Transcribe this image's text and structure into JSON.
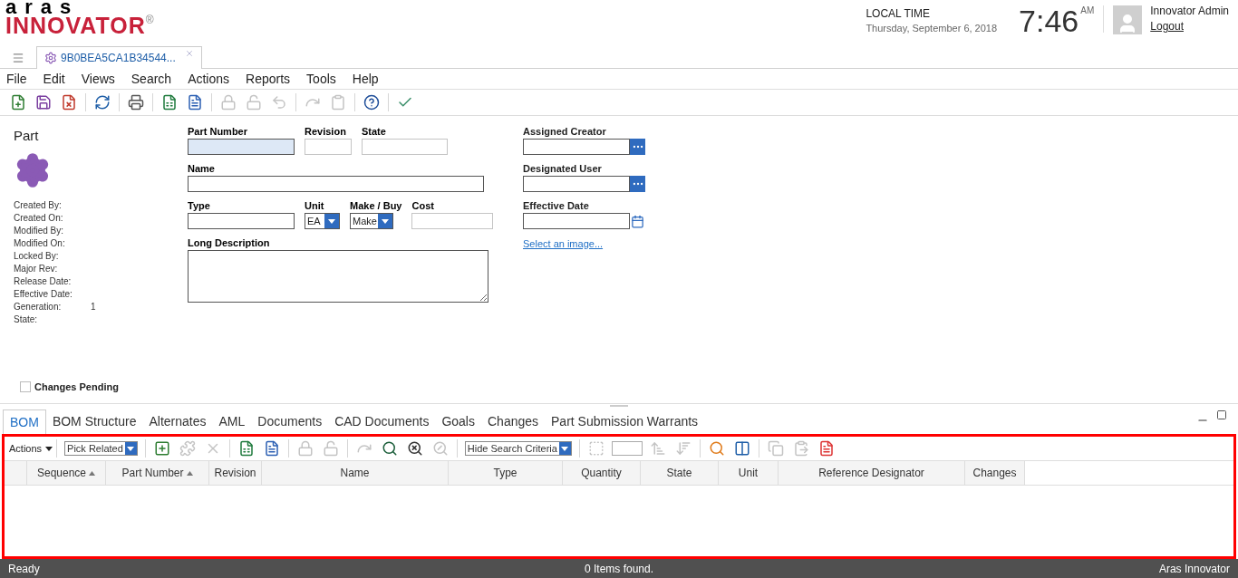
{
  "header": {
    "logo_top": "aras",
    "logo_main": "INNOVATOR",
    "logo_mark": "®",
    "local_time_label": "LOCAL TIME",
    "date": "Thursday, September 6, 2018",
    "time": "7:46",
    "meridiem": "AM",
    "user": "Innovator Admin",
    "logout": "Logout"
  },
  "doc_tab": {
    "title": "9B0BEA5CA1B34544...",
    "selected": true
  },
  "menu": [
    "File",
    "Edit",
    "Views",
    "Search",
    "Actions",
    "Reports",
    "Tools",
    "Help"
  ],
  "toolbar": [
    {
      "kind": "icon",
      "disabled": false
    },
    {
      "kind": "icon",
      "disabled": false
    },
    {
      "kind": "icon",
      "disabled": false
    },
    {
      "kind": "separator"
    },
    {
      "kind": "icon",
      "disabled": false
    },
    {
      "kind": "separator"
    },
    {
      "kind": "icon",
      "disabled": false
    },
    {
      "kind": "separator"
    },
    {
      "kind": "icon",
      "disabled": false
    },
    {
      "kind": "icon",
      "disabled": false
    },
    {
      "kind": "separator"
    },
    {
      "kind": "icon",
      "disabled": true
    },
    {
      "kind": "icon",
      "disabled": true
    },
    {
      "kind": "icon",
      "disabled": true
    },
    {
      "kind": "separator"
    },
    {
      "kind": "icon",
      "disabled": true
    },
    {
      "kind": "icon",
      "disabled": true
    },
    {
      "kind": "separator"
    },
    {
      "kind": "icon",
      "disabled": false
    },
    {
      "kind": "separator"
    },
    {
      "kind": "icon",
      "disabled": false
    }
  ],
  "item": {
    "type": "Part",
    "meta": [
      {
        "label": "Created By:"
      },
      {
        "label": "Created On:"
      },
      {
        "label": "Modified By:"
      },
      {
        "label": "Modified On:"
      },
      {
        "label": "Locked By:"
      },
      {
        "label": "Major Rev:"
      },
      {
        "label": "Release Date:"
      },
      {
        "label": "Effective Date:"
      },
      {
        "label": "Generation:",
        "value": "1"
      },
      {
        "label": "State:"
      }
    ],
    "changes_pending": {
      "label": "Changes Pending",
      "checked": false
    }
  },
  "form_rows": [
    [
      {
        "label": "Part Number",
        "kind": "text",
        "required": true,
        "disabled": false
      },
      {
        "label": "Revision",
        "kind": "text",
        "required": false,
        "disabled": true
      },
      {
        "label": "State",
        "kind": "text",
        "required": false,
        "disabled": true
      }
    ],
    [
      {
        "label": "Name",
        "kind": "text",
        "required": false,
        "disabled": false
      }
    ],
    [
      {
        "label": "Type",
        "kind": "text",
        "required": false,
        "disabled": false
      },
      {
        "label": "Unit",
        "kind": "select",
        "value": "EA"
      },
      {
        "label": "Make / Buy",
        "kind": "select",
        "value": "Make"
      },
      {
        "label": "Cost",
        "kind": "text",
        "required": false,
        "disabled": true
      }
    ],
    [
      {
        "label": "Long Description",
        "kind": "textarea"
      }
    ]
  ],
  "form_right": [
    {
      "label": "Assigned Creator",
      "kind": "lookup"
    },
    {
      "label": "Designated User",
      "kind": "lookup"
    },
    {
      "label": "Effective Date",
      "kind": "date"
    }
  ],
  "image_link": "Select an image...",
  "relationship_tabs": [
    {
      "label": "BOM",
      "selected": true
    },
    {
      "label": "BOM Structure",
      "selected": false
    },
    {
      "label": "Alternates",
      "selected": false
    },
    {
      "label": "AML",
      "selected": false
    },
    {
      "label": "Documents",
      "selected": false
    },
    {
      "label": "CAD Documents",
      "selected": false
    },
    {
      "label": "Goals",
      "selected": false
    },
    {
      "label": "Changes",
      "selected": false
    },
    {
      "label": "Part Submission Warrants",
      "selected": false
    }
  ],
  "grid_toolbar": [
    {
      "kind": "menu",
      "label": "Actions"
    },
    {
      "kind": "separator"
    },
    {
      "kind": "select",
      "value": "Pick Related"
    },
    {
      "kind": "separator"
    },
    {
      "kind": "icon",
      "disabled": false
    },
    {
      "kind": "icon",
      "disabled": true
    },
    {
      "kind": "icon",
      "disabled": true
    },
    {
      "kind": "separator"
    },
    {
      "kind": "icon",
      "disabled": false
    },
    {
      "kind": "icon",
      "disabled": false
    },
    {
      "kind": "separator"
    },
    {
      "kind": "icon",
      "disabled": true
    },
    {
      "kind": "icon",
      "disabled": true
    },
    {
      "kind": "separator"
    },
    {
      "kind": "icon",
      "disabled": true
    },
    {
      "kind": "icon",
      "disabled": false
    },
    {
      "kind": "icon",
      "disabled": false
    },
    {
      "kind": "icon",
      "disabled": true
    },
    {
      "kind": "separator"
    },
    {
      "kind": "select",
      "value": "Hide Search Criteria"
    },
    {
      "kind": "separator"
    },
    {
      "kind": "icon",
      "disabled": true
    },
    {
      "kind": "input"
    },
    {
      "kind": "icon",
      "disabled": true
    },
    {
      "kind": "icon",
      "disabled": true
    },
    {
      "kind": "separator"
    },
    {
      "kind": "icon",
      "disabled": false
    },
    {
      "kind": "icon",
      "disabled": false
    },
    {
      "kind": "separator"
    },
    {
      "kind": "icon",
      "disabled": true
    },
    {
      "kind": "icon",
      "disabled": true
    },
    {
      "kind": "icon",
      "disabled": false
    }
  ],
  "grid_columns": [
    {
      "label": "Sequence",
      "sorted": true
    },
    {
      "label": "Part Number",
      "sorted": true
    },
    {
      "label": "Revision",
      "sorted": false
    },
    {
      "label": "Name",
      "sorted": false
    },
    {
      "label": "Type",
      "sorted": false
    },
    {
      "label": "Quantity",
      "sorted": false
    },
    {
      "label": "State",
      "sorted": false
    },
    {
      "label": "Unit",
      "sorted": false
    },
    {
      "label": "Reference Designator",
      "sorted": false
    },
    {
      "label": "Changes",
      "sorted": false
    }
  ],
  "status_bar": {
    "left": "Ready",
    "center": "0 Items found.",
    "right": "Aras Innovator"
  }
}
